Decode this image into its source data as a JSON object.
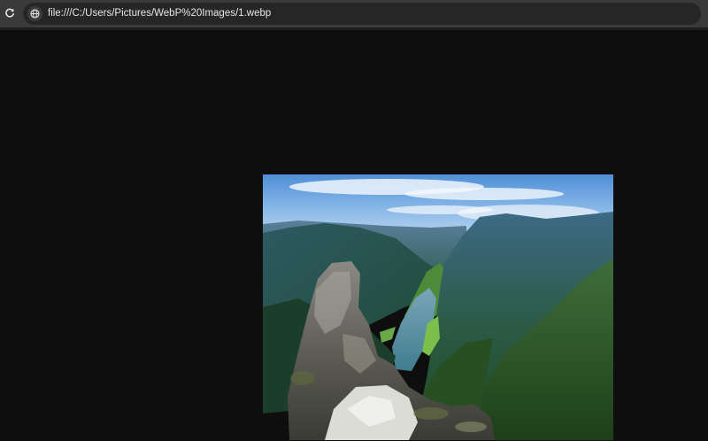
{
  "browser": {
    "url": "file:///C:/Users/Pictures/WebP%20Images/1.webp",
    "reload_icon": "reload-icon",
    "site_info_icon": "globe-icon"
  },
  "image": {
    "subject": "mountain-valley-photo",
    "alt": ""
  },
  "colors": {
    "toolbar": "#3a3a3a",
    "omnibox": "#262626",
    "page_background": "#0e0e0e",
    "url_text": "#e6e6e6"
  }
}
